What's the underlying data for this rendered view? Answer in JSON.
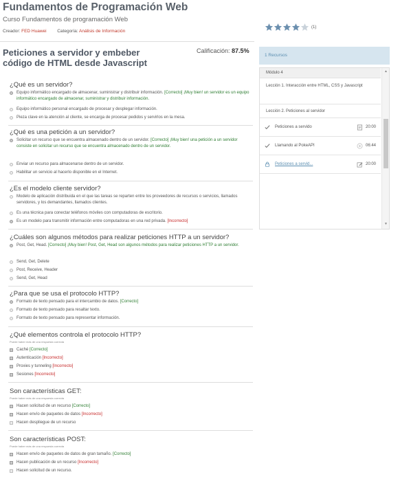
{
  "course": {
    "title": "Fundamentos de Programación Web",
    "subtitle": "Curso Fundamentos de programación Web",
    "creator_label": "Creador:",
    "creator": "FED Huawei",
    "category_label": "Categoría:",
    "category": "Análisis de Información",
    "rating": 4,
    "rating_max": 5,
    "rating_count": "(1)"
  },
  "lesson": {
    "title_line1": "Peticiones a servidor y embeber",
    "title_line2": "código de HTML desde Javascript",
    "grade_label": "Calificación:",
    "grade_value": "87.5%"
  },
  "questions": [
    {
      "title": "¿Qué es un servidor?",
      "type": "radio",
      "options": [
        {
          "text": "Equipo informático encargado de almacenar, suministrar y distribuir información.",
          "tag": "[Correcto]",
          "status": "ok",
          "feedback": "¡Muy bien! un servidor es un equipo informático encargado de almacenar, suministrar y distribuir información.",
          "selected": true
        },
        {
          "text": "Equipo informático personal encargado de procesar y desplegar información."
        },
        {
          "text": "Pieza clave en la atención al cliente, se encarga de procesar pedidos y servirlos en la mesa."
        }
      ]
    },
    {
      "title": "¿Qué es una petición a un servidor?",
      "type": "radio",
      "options": [
        {
          "text": "Solicitar un recurso que se encuentra almacenado dentro de un servidor.",
          "tag": "[Correcto]",
          "status": "ok",
          "feedback": "¡Muy bien! una petición a un servidor consiste en solicitar un recurso que se encuentra almacenado dentro de un servidor.",
          "selected": true
        },
        {
          "text": "Enviar un recurso para almacenarse dentro de un servidor."
        },
        {
          "text": "Habilitar un servicio al hacerlo disponible en el Internet."
        }
      ]
    },
    {
      "title": "¿Es el modelo cliente servidor?",
      "type": "radio",
      "options": [
        {
          "text": "Modelo de aplicación distribuida en el que las tareas se reparten entre los proveedores de recursos o servicios, llamados servidores, y los demandantes, llamados clientes."
        },
        {
          "text": "Es una técnica para conectar teléfonos móviles con computadoras de escritorio."
        },
        {
          "text": "Es un modelo para transmitir información entre computadoras en una red privada.",
          "tag": "[Incorrecto]",
          "status": "bad",
          "selected": true
        }
      ]
    },
    {
      "title": "¿Cuáles son algunos métodos para realizar peticiones HTTP a un servidor?",
      "type": "radio",
      "options": [
        {
          "text": "Post, Get, Head.",
          "tag": "[Correcto]",
          "status": "ok",
          "feedback": "¡Muy bien! Post, Get, Head son algunos métodos para realizar peticiones HTTP a un servidor.",
          "selected": true
        },
        {
          "text": "Send, Get, Delete"
        },
        {
          "text": "Post, Receive, Header"
        },
        {
          "text": "Send, Get, Head"
        }
      ]
    },
    {
      "title": "¿Para que se usa el protocolo HTTP?",
      "type": "radio",
      "options": [
        {
          "text": "Formato de texto pensado para el intercambio de datos.",
          "tag": "[Correcto]",
          "status": "ok",
          "selected": true
        },
        {
          "text": "Formato de texto pensado para resaltar texto."
        },
        {
          "text": "Formato de texto pensado para representar información."
        }
      ]
    },
    {
      "title": "¿Qué elementos controla el protocolo HTTP?",
      "hint": "Puede haber más de una respuesta correcta",
      "type": "check",
      "options": [
        {
          "text": "Caché",
          "tag": "[Correcto]",
          "status": "ok",
          "selected": true
        },
        {
          "text": "Autenticación",
          "tag": "[Incorrecto]",
          "status": "bad",
          "selected": true
        },
        {
          "text": "Proxies y tunneling",
          "tag": "[Incorrecto]",
          "status": "bad",
          "selected": true
        },
        {
          "text": "Sesiones",
          "tag": "[Incorrecto]",
          "status": "bad",
          "selected": true
        }
      ]
    },
    {
      "title": "Son características GET:",
      "hint": "Puede haber más de una respuesta correcta",
      "type": "check",
      "options": [
        {
          "text": "Hacen solicitud de un recurso",
          "tag": "[Correcto]",
          "status": "ok",
          "selected": true
        },
        {
          "text": "Hacen envío de paquetes de datos",
          "tag": "[Incorrecto]",
          "status": "bad",
          "selected": true
        },
        {
          "text": "Hacen despliegue de un recurso"
        }
      ]
    },
    {
      "title": "Son características POST:",
      "hint": "Puede haber más de una respuesta correcta",
      "type": "check",
      "options": [
        {
          "text": "Hacen envío de paquetes de datos de gran tamaño.",
          "tag": "[Correcto]",
          "status": "ok",
          "selected": true
        },
        {
          "text": "Hacen publicación de un recurso",
          "tag": "[Incorrecto]",
          "status": "bad",
          "selected": true
        },
        {
          "text": "Hacen solicitud de un recurso."
        }
      ]
    }
  ],
  "sidebar": {
    "resources_label": "1 Recursos",
    "module": "Módulo 4",
    "lesson1": "Lección 1. Interacción entre HTML, CSS y Javascript",
    "lesson2": "Lección 2. Peticiones al servidor",
    "items": [
      {
        "name": "Peticiones a servido",
        "duration": "20:00",
        "icon": "check-icon",
        "type_icon": "document-icon"
      },
      {
        "name": "Llamando al PokeAPI",
        "duration": "06:44",
        "icon": "check-icon",
        "type_icon": "play-icon"
      },
      {
        "name": "Peticiones a servid...",
        "duration": "20:00",
        "icon": "lock-icon",
        "type_icon": "edit-icon",
        "active": true
      }
    ]
  },
  "colors": {
    "correct": "#2e7d32",
    "incorrect": "#c62828",
    "accent": "#5a8db0",
    "star": "#6b8fae"
  }
}
